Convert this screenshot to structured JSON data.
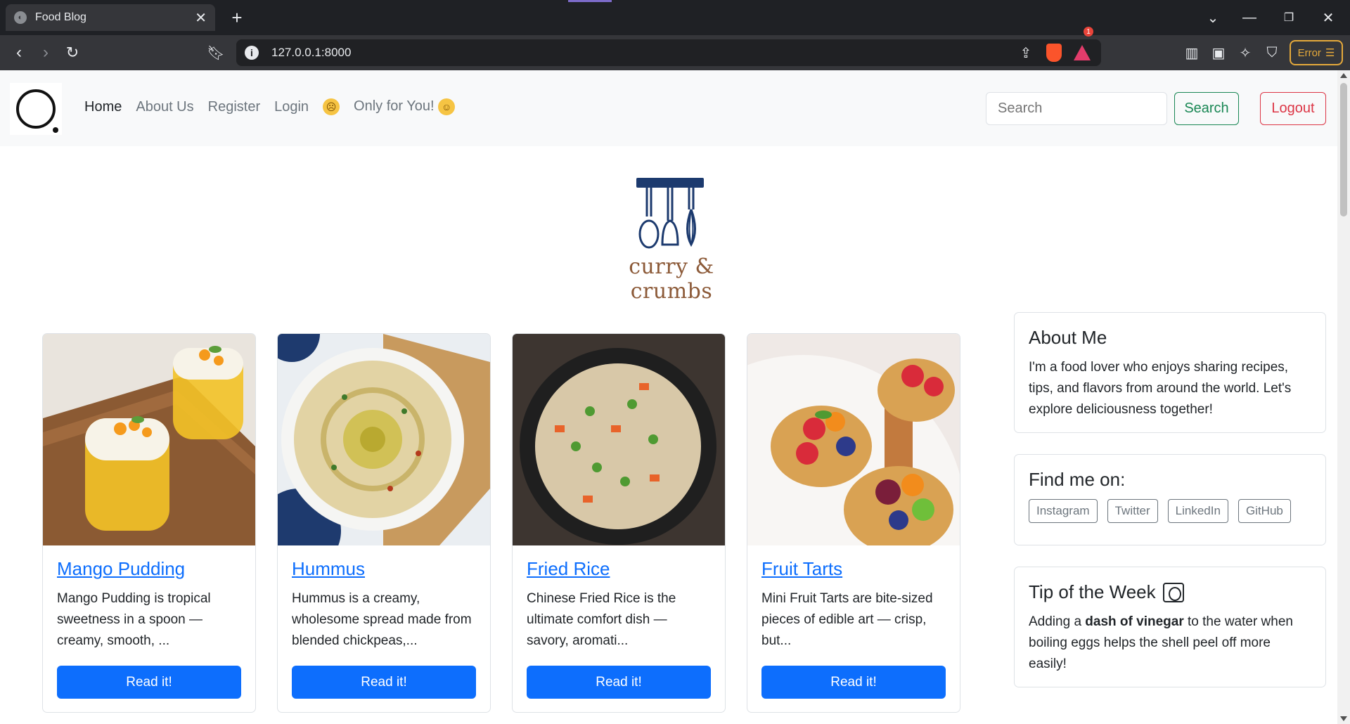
{
  "browser": {
    "tab_title": "Food Blog",
    "url": "127.0.0.1:8000",
    "error_label": "Error"
  },
  "nav": {
    "links": [
      "Home",
      "About Us",
      "Register",
      "Login",
      "Only for You!"
    ],
    "search_placeholder": "Search",
    "search_button": "Search",
    "logout_button": "Logout"
  },
  "brand": {
    "name": "curry & crumbs"
  },
  "cards": [
    {
      "title": "Mango Pudding",
      "text": "Mango Pudding is tropical sweetness in a spoon — creamy, smooth, ...",
      "button": "Read it!"
    },
    {
      "title": "Hummus",
      "text": "Hummus is a creamy, wholesome spread made from blended chickpeas,...",
      "button": "Read it!"
    },
    {
      "title": "Fried Rice",
      "text": "Chinese Fried Rice is the ultimate comfort dish — savory, aromati...",
      "button": "Read it!"
    },
    {
      "title": "Fruit Tarts",
      "text": "Mini Fruit Tarts are bite-sized pieces of edible art — crisp, but...",
      "button": "Read it!"
    }
  ],
  "sidebar": {
    "about": {
      "title": "About Me",
      "text": "I'm a food lover who enjoys sharing recipes, tips, and flavors from around the world. Let's explore deliciousness together!"
    },
    "find": {
      "title": "Find me on:",
      "links": [
        "Instagram",
        "Twitter",
        "LinkedIn",
        "GitHub"
      ]
    },
    "tip": {
      "title": "Tip of the Week",
      "text_before": "Adding a ",
      "text_bold": "dash of vinegar",
      "text_after": " to the water when boiling eggs helps the shell peel off more easily!"
    }
  },
  "colors": {
    "primary": "#0d6efd",
    "success": "#198754",
    "danger": "#dc3545",
    "brand_navy": "#1c3a6e",
    "brand_brown": "#8c5a38"
  }
}
